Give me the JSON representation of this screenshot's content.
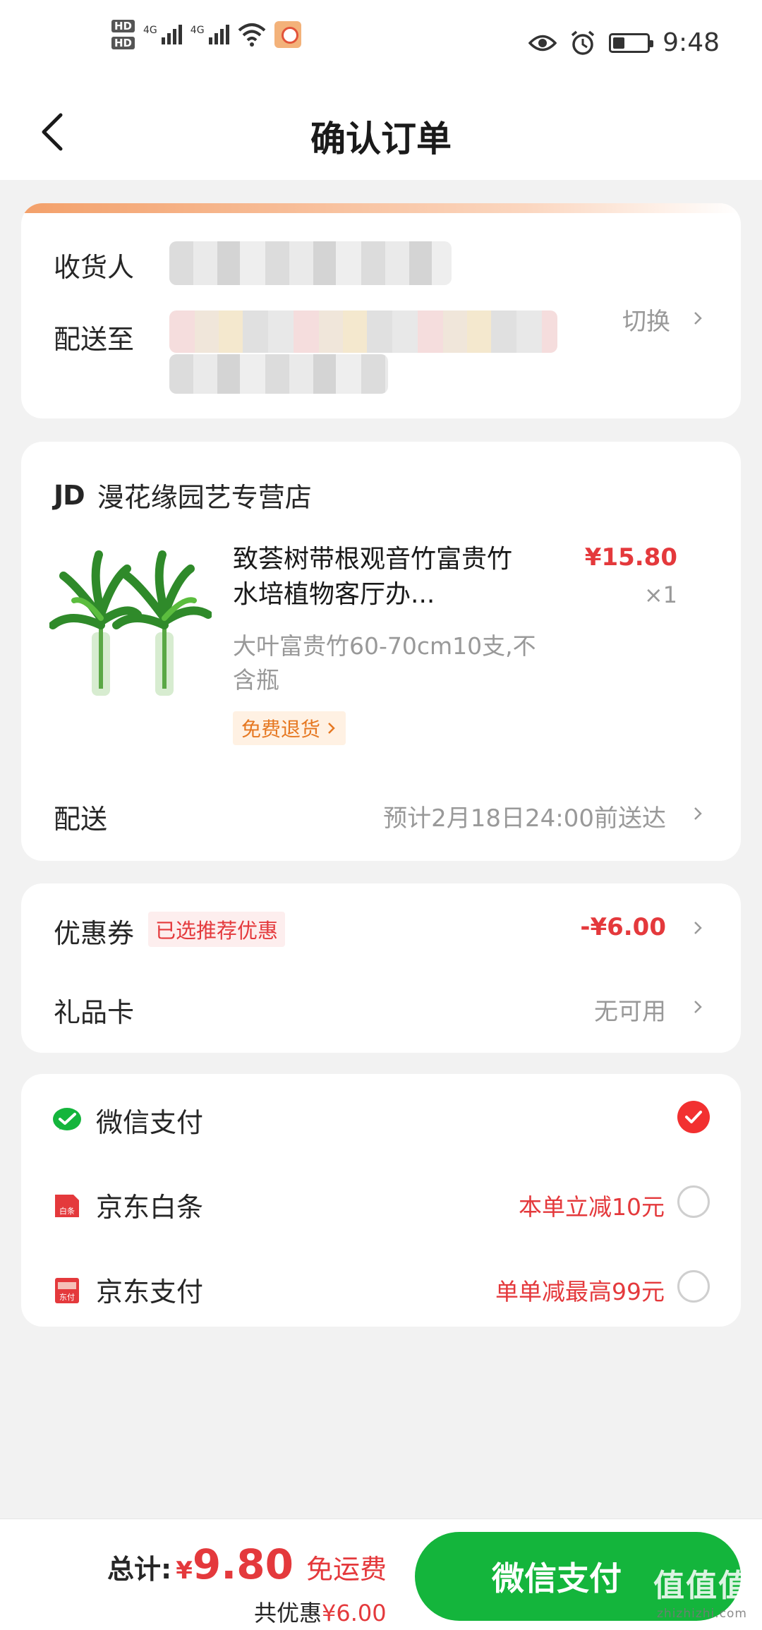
{
  "status_bar": {
    "hd1": "HD",
    "hd2": "HD",
    "sig1": "4G",
    "sig2": "4G",
    "time": "9:48"
  },
  "nav": {
    "title": "确认订单"
  },
  "address": {
    "receiver_label": "收货人",
    "deliver_to_label": "配送至",
    "switch_label": "切换"
  },
  "store": {
    "logo": "JD",
    "name": "漫花缘园艺专营店",
    "product": {
      "title": "致荟树带根观音竹富贵竹水培植物客厅办...",
      "price": "¥15.80",
      "qty": "×1",
      "spec": "大叶富贵竹60-70cm10支,不含瓶",
      "return_badge": "免费退货"
    },
    "delivery_label": "配送",
    "delivery_value": "预计2月18日24:00前送达"
  },
  "discounts": {
    "coupon_label": "优惠券",
    "coupon_tag": "已选推荐优惠",
    "coupon_value": "-¥6.00",
    "giftcard_label": "礼品卡",
    "giftcard_value": "无可用"
  },
  "payment": {
    "methods": [
      {
        "label": "微信支付",
        "promo": "",
        "selected": true
      },
      {
        "label": "京东白条",
        "promo": "本单立减10元",
        "selected": false
      },
      {
        "label": "京东支付",
        "promo": "单单减最高99元",
        "selected": false
      }
    ],
    "icon_text_baitiao": "白条",
    "icon_text_jdpay": "东付"
  },
  "bottom": {
    "total_label": "总计:",
    "currency": "¥",
    "total_amount": "9.80",
    "free_shipping": "免运费",
    "saved_prefix": "共优惠",
    "saved_amount": "¥6.00",
    "pay_button": "微信支付",
    "watermark": "值值值",
    "watermark_url": "zhizhizhi.com"
  },
  "colors": {
    "accent_red": "#e4393c",
    "wechat_green": "#14b53c"
  }
}
